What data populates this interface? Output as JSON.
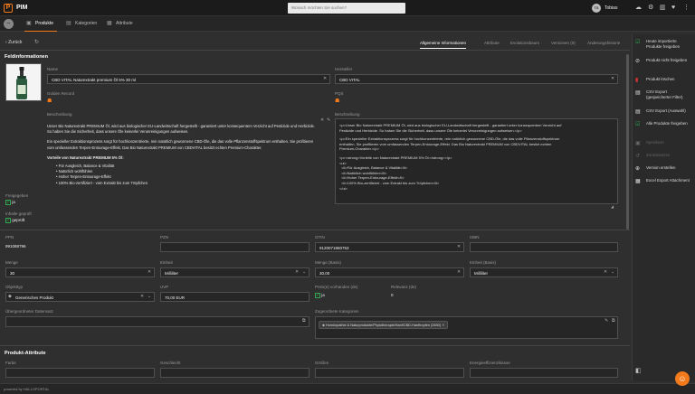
{
  "app": {
    "name": "PIM",
    "logo_letter": "P"
  },
  "search": {
    "placeholder": "Wonach möchten Sie suchen?"
  },
  "user": {
    "initials": "TS",
    "name": "Tobias"
  },
  "nav": {
    "tabs": [
      "Produkte",
      "Kategorien",
      "Attribute"
    ]
  },
  "detail": {
    "back_label": "Zurück",
    "tabs": [
      "Allgemeine Informationen",
      "Attribute",
      "Evolutionsbaum",
      "Versionen (0)",
      "Änderungshistorie"
    ]
  },
  "feld": {
    "section_title": "Feldinformationen",
    "name_label": "Name",
    "name_value": "CBD VITAL Naturextrakt premium Öl 5% 30 ml",
    "hersteller_label": "Hersteller",
    "hersteller_value": "CBD VITAL",
    "golden_label": "Golden Record",
    "pqs_label": "PQS",
    "beschreibung_label": "Beschreibung",
    "beschreibung_html_label": "Beschreibung",
    "desc_p1": "Unser Bio Naturextrakt PREMIUM Öl, wird aus biologischer EU-Landwirtschaft hergestellt - garantiert unter konsequentem Verzicht auf Pestizide und Herbizide. So haben Sie die Sicherheit, dass unsere Öle keinerlei Verunreinigungen aufweisen.",
    "desc_p2": "Ein spezieller Extraktionsprozess sorgt für hochkonzentrierte, rein natürlich gewonnene CBD-Öle, die das volle Pflanzenstoffspektrum enthalten. Sie profitieren vom umfassenden Terpen-Entourage-Effekt. Das Bio Naturextrakt PREMIUM von CBDVITAL besitzt echten Premium-Charakter.",
    "desc_heading": "Vorteile von Naturextrakt PREMIUM 5% Öl:",
    "desc_items": [
      "Für Ausgleich, Balance & Vitalität",
      "Natürlich wohlfühlen",
      "Hoher Terpen-Entourage-Effekt",
      "100% Bio-zertifiziert - vom Extrakt bis zum Tröpfchen"
    ],
    "html_lines": [
      "<p>Unser Bio Naturextrakt PREMIUM Öl, wird aus biologischer EU-Landwirtschaft hergestellt - garantiert unter konsequentem Verzicht auf",
      "Pestizide und Herbizide. So haben Sie die Sicherheit, dass unsere Öle keinerlei Verunreinigungen aufweisen.</p>",
      "",
      "<p>Ein spezieller Extraktionsprozess sorgt für hochkonzentrierte, rein natürlich gewonnene CBD-Öle, die das volle Pflanzenstoffspektrum",
      "enthalten. Sie profitieren vom umfassenden Terpen-Entourage-Effekt. Das Bio Naturextrakt PREMIUM von CBDVITAL besitzt echten",
      "Premium-Charakter.</p>",
      "",
      "<p><strong>Vorteile von Naturextrakt PREMIUM 5% Öl:</strong></p>",
      "<ul>",
      "  <li>Für Ausgleich, Balance & Vitalität</li>",
      "  <li>Natürlich wohlfühlen</li>",
      "  <li>Hoher Terpen-Entourage-Effekt</li>",
      "  <li>100% Bio-zertifiziert - vom Extrakt bis zum Tröpfchen</li>",
      "</ul>"
    ],
    "freigegeben_label": "Freigegeben",
    "freigegeben_value": "ja",
    "inhalte_label": "Inhalte geprüft",
    "inhalte_value": "geprüft"
  },
  "fields": {
    "ppn_label": "PPN",
    "ppn_value": "991088796",
    "pzn_label": "PZN",
    "pzn_value": "",
    "gtin_label": "GTIN",
    "gtin_value": "9120071860753",
    "isbn_label": "ISBN",
    "isbn_value": "",
    "menge_label": "Menge",
    "menge_value": "30",
    "einheit_label": "Einheit",
    "einheit_value": "Milliliter",
    "menge_basis_label": "Menge (Basis)",
    "menge_basis_value": "30,00",
    "einheit_basis_label": "Einheit (Basis)",
    "einheit_basis_value": "Milliliter",
    "objekttyp_label": "Objekttyp",
    "objekttyp_value": "Generisches Produkt",
    "uvp_label": "UVP",
    "uvp_value": "70,00 EUR",
    "preis_label": "Preis(e) vorhanden (de)",
    "preis_value": "ja",
    "relevanz_label": "Relevanz (de)",
    "relevanz_value": "0",
    "uebergeordnet_label": "Übergeordneter Datensatz",
    "kategorien_label": "Zugeordnete Kategorien",
    "kategorie_value": "Homöopathie & Naturprodukte/Phytotherapie/Hanf/CBD-Hanftropfen (2630)"
  },
  "attr": {
    "section_title": "Produkt-Attribute",
    "labels": [
      "Farbe",
      "Geschlecht",
      "Größen",
      "Energieeffizienzklasse"
    ]
  },
  "sidebar": {
    "items": [
      {
        "label": "Heute importierte Produkte freigeben",
        "icon": "check-list-icon",
        "color": "#2fa84f",
        "enabled": true
      },
      {
        "label": "Produkt nicht freigeben",
        "icon": "block-icon",
        "color": "#dddddd",
        "enabled": true
      },
      {
        "label": "Produkt löschen",
        "icon": "trash-icon",
        "color": "#e03030",
        "enabled": true
      },
      {
        "label": "CSV Export (gespeicherter Filter)",
        "icon": "csv-icon",
        "color": "#dddddd",
        "enabled": true
      },
      {
        "label": "CSV Export (Auswahl)",
        "icon": "csv-icon",
        "color": "#dddddd",
        "enabled": true
      },
      {
        "label": "Alle Produkte freigeben",
        "icon": "check-all-icon",
        "color": "#2fa84f",
        "enabled": true
      },
      {
        "label": "Speichern",
        "icon": "save-icon",
        "color": "#666666",
        "enabled": false
      },
      {
        "label": "Zurücksetzen",
        "icon": "reset-icon",
        "color": "#666666",
        "enabled": false
      },
      {
        "label": "Version erstellen",
        "icon": "version-icon",
        "color": "#dddddd",
        "enabled": true
      },
      {
        "label": "Excel Export Attachment",
        "icon": "excel-icon",
        "color": "#dddddd",
        "enabled": true
      }
    ]
  },
  "footer": {
    "text": "powered by HALLOPORTAL"
  },
  "colors": {
    "accent": "#f27a1a",
    "ok": "#2fa84f",
    "danger": "#e03030"
  }
}
